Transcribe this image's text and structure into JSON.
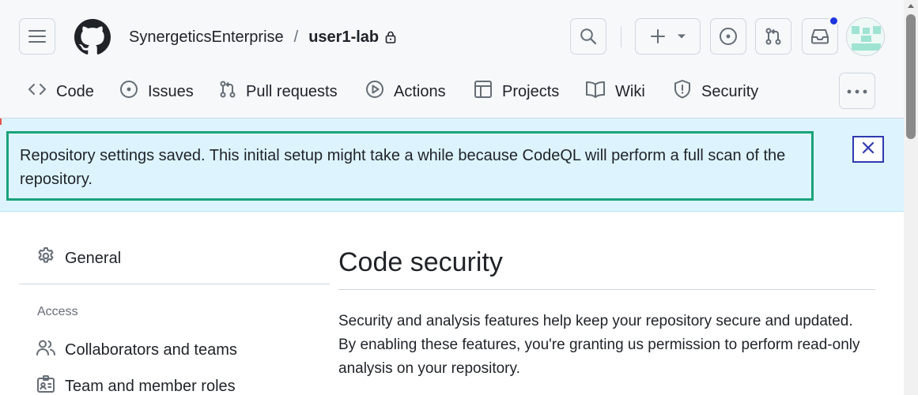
{
  "header": {
    "owner": "SynergeticsEnterprise",
    "separator": "/",
    "repo": "user1-lab",
    "icons": {
      "menu": "hamburger-icon",
      "logo": "github-logo",
      "search": "search-icon",
      "create": "plus-icon",
      "issues": "issue-opened-icon",
      "pull_requests": "git-pull-request-icon",
      "inbox": "inbox-icon",
      "notification": "notification-dot"
    },
    "notification_color": "#1f35e0"
  },
  "repo_nav": {
    "tabs": [
      {
        "label": "Code",
        "icon": "code-icon"
      },
      {
        "label": "Issues",
        "icon": "issue-opened-icon"
      },
      {
        "label": "Pull requests",
        "icon": "git-pull-request-icon"
      },
      {
        "label": "Actions",
        "icon": "play-icon"
      },
      {
        "label": "Projects",
        "icon": "table-icon"
      },
      {
        "label": "Wiki",
        "icon": "book-icon"
      },
      {
        "label": "Security",
        "icon": "shield-icon"
      }
    ],
    "more_icon": "kebab-horizontal-icon"
  },
  "flash": {
    "message": "Repository settings saved. This initial setup might take a while because CodeQL will perform a full scan of the repository.",
    "close_icon": "x-icon",
    "background": "#ddf4ff",
    "highlight_border": "#1aa37a"
  },
  "sidebar": {
    "general": "General",
    "access_heading": "Access",
    "items": [
      {
        "label": "Collaborators and teams",
        "icon": "people-icon"
      },
      {
        "label": "Team and member roles",
        "icon": "id-badge-icon"
      }
    ]
  },
  "main": {
    "title": "Code security",
    "intro": "Security and analysis features help keep your repository secure and updated. By enabling these features, you're granting us permission to perform read-only analysis on your repository."
  }
}
